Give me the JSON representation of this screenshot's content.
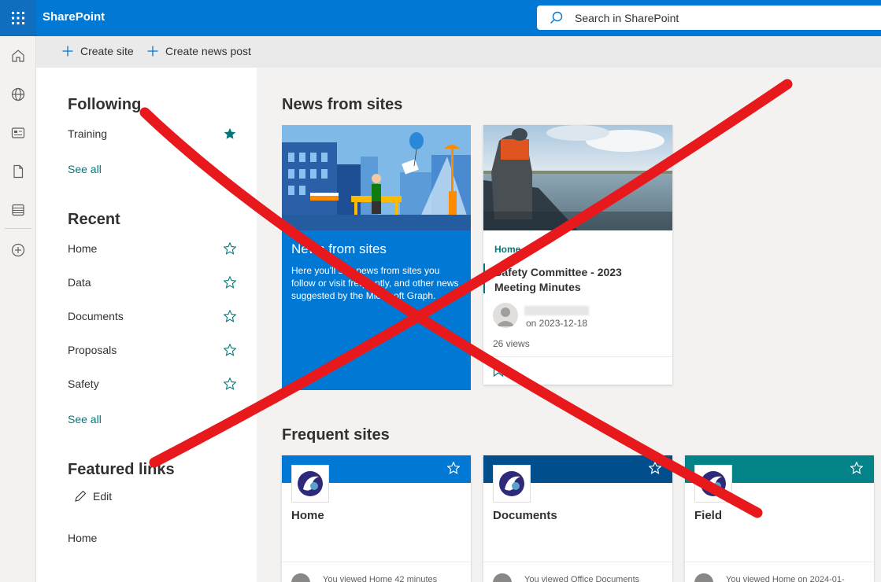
{
  "app": {
    "brand": "SharePoint",
    "search_placeholder": "Search in SharePoint"
  },
  "rail": {
    "icons": [
      "home-icon",
      "globe-icon",
      "news-icon",
      "document-icon",
      "list-icon",
      "add-circle-icon"
    ]
  },
  "commands": {
    "create_site": "Create site",
    "create_news_post": "Create news post"
  },
  "following": {
    "heading": "Following",
    "items": [
      {
        "label": "Training",
        "followed": true
      }
    ],
    "see_all": "See all"
  },
  "recent": {
    "heading": "Recent",
    "items": [
      {
        "label": "Home"
      },
      {
        "label": "Data"
      },
      {
        "label": "Documents"
      },
      {
        "label": "Proposals"
      },
      {
        "label": "Safety"
      }
    ],
    "see_all": "See all"
  },
  "featured_links": {
    "heading": "Featured links",
    "edit_label": "Edit",
    "items": [
      {
        "label": "Home"
      }
    ]
  },
  "news": {
    "heading": "News from sites",
    "intro_card": {
      "title": "News from sites",
      "description": "Here you'll see news from sites you follow or visit frequently, and other news suggested by the Microsoft Graph."
    },
    "article": {
      "site": "Home",
      "title": "Safety Committee - 2023 Meeting Minutes",
      "date": "on 2023-12-18",
      "views": "26 views"
    }
  },
  "frequent": {
    "heading": "Frequent sites",
    "sites": [
      {
        "name": "Home",
        "band_color": "#0078d4",
        "activity": "You viewed Home 42 minutes"
      },
      {
        "name": "Documents",
        "band_color": "#004e8c",
        "activity": "You viewed Office Documents"
      },
      {
        "name": "Field",
        "band_color": "#038387",
        "activity": "You viewed Home on 2024-01-"
      }
    ]
  },
  "colors": {
    "suite_bar": "#0078d4",
    "accent_teal": "#03787c",
    "annotation_red": "#e8191c"
  }
}
